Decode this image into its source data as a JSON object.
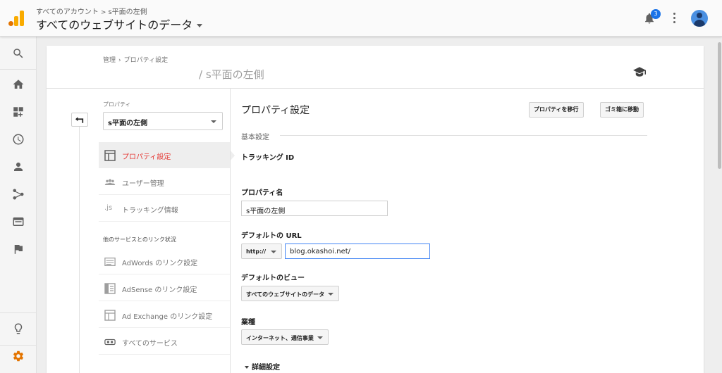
{
  "header": {
    "breadcrumb_account": "すべてのアカウント",
    "breadcrumb_sep": ">",
    "breadcrumb_property": "s平面の左側",
    "view_title": "すべてのウェブサイトのデータ",
    "notification_count": "3"
  },
  "rail": {
    "icons": [
      "search-icon",
      "home-icon",
      "dashboard-icon",
      "clock-icon",
      "person-icon",
      "fork-icon",
      "browser-icon",
      "flag-icon",
      "lightbulb-icon",
      "gear-icon"
    ]
  },
  "admin": {
    "crumb_admin": "管理",
    "crumb_sep": "›",
    "crumb_page": "プロパティ設定",
    "title": "/ s平面の左側"
  },
  "left": {
    "property_label": "プロパティ",
    "property_value": "s平面の左側",
    "nav": [
      {
        "label": "プロパティ設定",
        "icon": "layout-icon"
      },
      {
        "label": "ユーザー管理",
        "icon": "users-icon"
      },
      {
        "label": "トラッキング情報",
        "icon": "js-icon"
      }
    ],
    "link_section": "他のサービスとのリンク状況",
    "links": [
      {
        "label": "AdWords のリンク設定",
        "icon": "adwords-icon"
      },
      {
        "label": "AdSense のリンク設定",
        "icon": "adsense-icon"
      },
      {
        "label": "Ad Exchange のリンク設定",
        "icon": "adexchange-icon"
      },
      {
        "label": "すべてのサービス",
        "icon": "link-icon"
      }
    ],
    "js_glyph": ".js"
  },
  "main": {
    "heading": "プロパティ設定",
    "move_button": "プロパティを移行",
    "trash_button": "ゴミ箱に移動",
    "basic_section": "基本設定",
    "tracking_id_label": "トラッキング ID",
    "property_name_label": "プロパティ名",
    "property_name_value": "s平面の左側",
    "default_url_label": "デフォルトの URL",
    "protocol_value": "http://",
    "url_value": "blog.okashoi.net/",
    "default_view_label": "デフォルトのビュー",
    "default_view_value": "すべてのウェブサイトのデータ",
    "industry_label": "業種",
    "industry_value": "インターネット、通信事業",
    "advanced_label": "詳細設定"
  },
  "colors": {
    "accent": "#e37400",
    "active_nav": "#e53935",
    "badge": "#1a73e8"
  }
}
